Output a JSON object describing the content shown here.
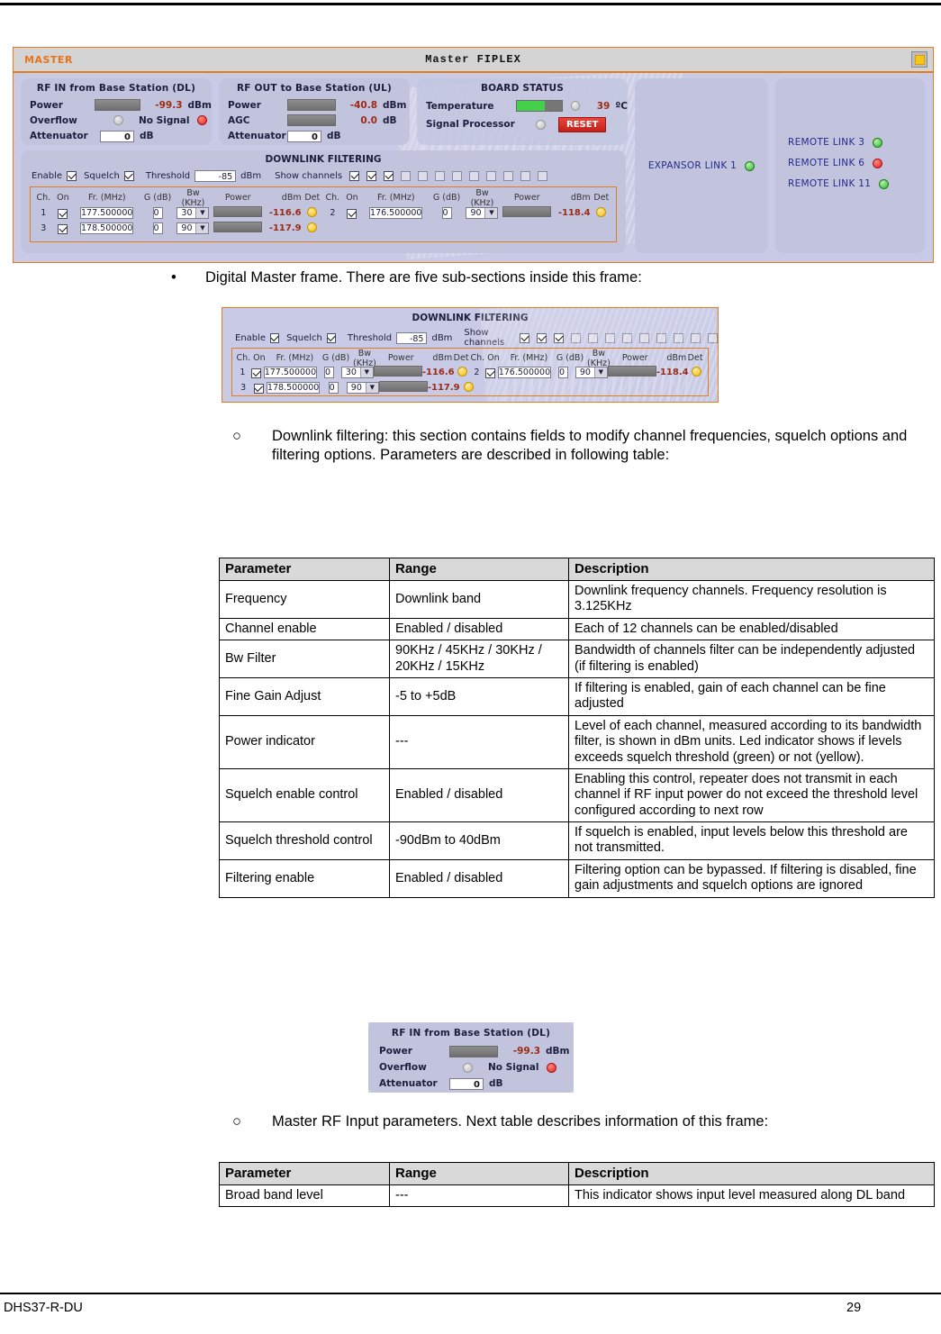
{
  "document": {
    "footer_left": "DHS37-R-DU",
    "footer_page": "29"
  },
  "bullets": {
    "b1": "Digital Master frame. There are five  sub-sections inside this frame:",
    "b1_marker": "•",
    "b2": "Downlink filtering: this section contains fields to modify channel frequencies, squelch options and filtering options. Parameters are described in following table:",
    "b2_marker": "○",
    "b3": "Master RF Input parameters. Next table describes information of this frame:",
    "b3_marker": "○"
  },
  "screenshot": {
    "titlebar": {
      "left_label": "MASTER",
      "center_title": "Master FIPLEX",
      "minimize_icon": "minimize-icon"
    },
    "rf_in": {
      "title": "RF IN from Base Station (DL)",
      "power_label": "Power",
      "power_value": "-99.3",
      "power_unit": "dBm",
      "overflow_label": "Overflow",
      "overflow_led": "grey",
      "no_signal_label": "No Signal",
      "no_signal_led": "red",
      "attenuator_label": "Attenuator",
      "attenuator_value": "0",
      "attenuator_unit": "dB"
    },
    "rf_out": {
      "title": "RF OUT to Base Station (UL)",
      "power_label": "Power",
      "power_value": "-40.8",
      "power_unit": "dBm",
      "agc_label": "AGC",
      "agc_value": "0.0",
      "agc_unit": "dB",
      "attenuator_label": "Attenuator",
      "attenuator_value": "0",
      "attenuator_unit": "dB"
    },
    "board_status": {
      "title": "BOARD STATUS",
      "temperature_label": "Temperature",
      "temperature_value": "39",
      "temperature_unit": "ºC",
      "temperature_led": "grey",
      "signal_processor_label": "Signal Processor",
      "signal_processor_led": "grey",
      "reset_label": "RESET"
    },
    "expansor": {
      "link_label": "EXPANSOR LINK 1",
      "led": "green"
    },
    "remote_links": [
      {
        "label": "REMOTE LINK 3",
        "led": "green"
      },
      {
        "label": "REMOTE LINK 6",
        "led": "red"
      },
      {
        "label": "REMOTE LINK 11",
        "led": "green"
      }
    ],
    "downlink": {
      "title": "DOWNLINK FILTERING",
      "enable_label": "Enable",
      "enable_checked": true,
      "squelch_label": "Squelch",
      "squelch_checked": true,
      "threshold_label": "Threshold",
      "threshold_value": "-85",
      "threshold_unit": "dBm",
      "show_channels_label": "Show channels",
      "show_channels": [
        true,
        true,
        true,
        false,
        false,
        false,
        false,
        false,
        false,
        false,
        false,
        false
      ],
      "headers": [
        "Ch.",
        "On",
        "Fr. (MHz)",
        "G (dB)",
        "Bw (KHz)",
        "Power",
        "dBm",
        "Det"
      ],
      "channels_left": [
        {
          "ch": "1",
          "on": true,
          "freq": "177.500000",
          "gain": "0",
          "bw": "30",
          "dbm": "-116.6",
          "det": "yellow"
        },
        {
          "ch": "3",
          "on": true,
          "freq": "178.500000",
          "gain": "0",
          "bw": "90",
          "dbm": "-117.9",
          "det": "yellow"
        }
      ],
      "channels_right": [
        {
          "ch": "2",
          "on": true,
          "freq": "176.500000",
          "gain": "0",
          "bw": "90",
          "dbm": "-118.4",
          "det": "yellow"
        }
      ]
    }
  },
  "table_downlink": {
    "headers": [
      "Parameter",
      "Range",
      "Description"
    ],
    "rows": [
      [
        "Frequency",
        "Downlink band",
        "Downlink frequency channels. Frequency resolution is 3.125KHz"
      ],
      [
        "Channel enable",
        "Enabled / disabled",
        "Each of 12 channels can be enabled/disabled"
      ],
      [
        "Bw Filter",
        "90KHz / 45KHz / 30KHz / 20KHz / 15KHz",
        "Bandwidth of channels filter can be independently adjusted (if filtering is enabled)"
      ],
      [
        "Fine Gain Adjust",
        "-5 to +5dB",
        "If filtering is enabled, gain of each channel can be fine adjusted"
      ],
      [
        "Power indicator",
        "---",
        "Level of each channel, measured according to its bandwidth filter, is shown in dBm units. Led indicator shows if levels exceeds squelch threshold (green) or not (yellow)."
      ],
      [
        "Squelch enable control",
        "Enabled / disabled",
        "Enabling this control, repeater does not transmit in each channel if RF input power do not exceed the threshold level configured according to next row"
      ],
      [
        "Squelch threshold control",
        "-90dBm to 40dBm",
        "If squelch is enabled, input levels below this threshold are not transmitted."
      ],
      [
        "Filtering enable",
        "Enabled / disabled",
        "Filtering option can be bypassed. If filtering is disabled, fine gain adjustments and squelch options are ignored"
      ]
    ]
  },
  "table_rfinput": {
    "headers": [
      "Parameter",
      "Range",
      "Description"
    ],
    "rows": [
      [
        "Broad band level",
        "---",
        "This indicator shows input level measured along DL band"
      ]
    ]
  },
  "colors": {
    "accent_orange": "#e07b20",
    "panel_blue": "#c2c4de",
    "body_blue": "#c9cbe6",
    "value_red": "#9c2a14",
    "link_blue": "#262a8c",
    "reset_red": "#c3201a",
    "table_header_grey": "#d9d9d9"
  }
}
